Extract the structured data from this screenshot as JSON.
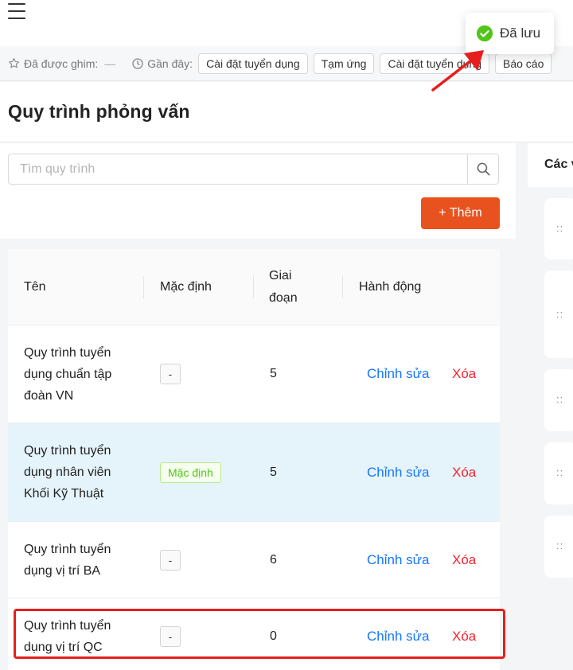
{
  "pinbar": {
    "pinned_label": "Đã được ghim:",
    "pinned_value": "—",
    "recent_label": "Gần đây:",
    "recent_chips": [
      "Cài đặt tuyển dụng",
      "Tạm ứng",
      "Cài đặt tuyển dụng",
      "Báo cáo"
    ]
  },
  "page": {
    "title": "Quy trình phỏng vấn"
  },
  "search": {
    "placeholder": "Tìm quy trình"
  },
  "add_button": "+ Thêm",
  "table": {
    "headers": {
      "name": "Tên",
      "default": "Mặc định",
      "stages": "Giai đoạn",
      "actions": "Hành động"
    },
    "rows": [
      {
        "name": "Quy trình tuyển dụng chuẩn tập đoàn VN",
        "default": "-",
        "stages": "5",
        "edit": "Chỉnh sửa",
        "delete": "Xóa"
      },
      {
        "name": "Quy trình tuyển dụng nhân viên Khối Kỹ Thuật",
        "default": "Mặc định",
        "stages": "5",
        "edit": "Chỉnh sửa",
        "delete": "Xóa"
      },
      {
        "name": "Quy trình tuyển dụng vị trí BA",
        "default": "-",
        "stages": "6",
        "edit": "Chỉnh sửa",
        "delete": "Xóa"
      },
      {
        "name": "Quy trình tuyển dụng vị trí QC",
        "default": "-",
        "stages": "0",
        "edit": "Chỉnh sửa",
        "delete": "Xóa"
      }
    ]
  },
  "right_panel": {
    "title": "Các v"
  },
  "toast": {
    "message": "Đã lưu",
    "icon": "check-circle-icon",
    "color": "#52c41a"
  },
  "colors": {
    "primary": "#e8521e",
    "link": "#1677ff",
    "danger": "#f5222d",
    "highlight_row": "#e5f4fb",
    "annotation": "#e61e1e"
  }
}
